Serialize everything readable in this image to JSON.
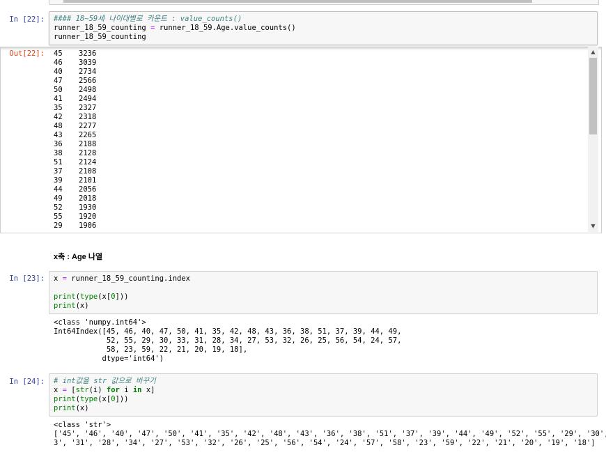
{
  "cell22": {
    "prompt_in": "In [22]:",
    "code": {
      "comment": "#### 18~59세 나이대별로 카운트 : value_counts()",
      "line2_a": "runner_18_59_counting ",
      "line2_op": "=",
      "line2_b": " runner_18_59.Age.value_counts()",
      "line3": "runner_18_59_counting"
    },
    "prompt_out": "Out[22]:",
    "value_counts": [
      {
        "age": "45",
        "count": "3236"
      },
      {
        "age": "46",
        "count": "3039"
      },
      {
        "age": "40",
        "count": "2734"
      },
      {
        "age": "47",
        "count": "2566"
      },
      {
        "age": "50",
        "count": "2498"
      },
      {
        "age": "41",
        "count": "2494"
      },
      {
        "age": "35",
        "count": "2327"
      },
      {
        "age": "42",
        "count": "2318"
      },
      {
        "age": "48",
        "count": "2277"
      },
      {
        "age": "43",
        "count": "2265"
      },
      {
        "age": "36",
        "count": "2188"
      },
      {
        "age": "38",
        "count": "2128"
      },
      {
        "age": "51",
        "count": "2124"
      },
      {
        "age": "37",
        "count": "2108"
      },
      {
        "age": "39",
        "count": "2101"
      },
      {
        "age": "44",
        "count": "2056"
      },
      {
        "age": "49",
        "count": "2018"
      },
      {
        "age": "52",
        "count": "1930"
      },
      {
        "age": "55",
        "count": "1920"
      },
      {
        "age": "29",
        "count": "1906"
      }
    ]
  },
  "markdown": {
    "text": "x축 : Age 나열"
  },
  "cell23": {
    "prompt_in": "In [23]:",
    "code": {
      "l1_a": "x ",
      "l1_op": "=",
      "l1_b": " runner_18_59_counting.index",
      "l3_fn": "print",
      "l3_a": "(",
      "l3_fn2": "type",
      "l3_b": "(x[",
      "l3_num": "0",
      "l3_c": "]))",
      "l4_fn": "print",
      "l4_b": "(x)"
    },
    "output": [
      "<class 'numpy.int64'>",
      "Int64Index([45, 46, 40, 47, 50, 41, 35, 42, 48, 43, 36, 38, 51, 37, 39, 44, 49,",
      "            52, 55, 29, 30, 33, 31, 28, 34, 27, 53, 32, 26, 25, 56, 54, 24, 57,",
      "            58, 23, 59, 22, 21, 20, 19, 18],",
      "           dtype='int64')"
    ]
  },
  "cell24": {
    "prompt_in": "In [24]:",
    "code": {
      "comment": "# int값을 str 값으로 바꾸기",
      "l2_a": "x ",
      "l2_op": "=",
      "l2_b": " [",
      "l2_fn": "str",
      "l2_c": "(i) ",
      "l2_kw1": "for",
      "l2_d": " i ",
      "l2_kw2": "in",
      "l2_e": " x]",
      "l3_fn": "print",
      "l3_a": "(",
      "l3_fn2": "type",
      "l3_b": "(x[",
      "l3_num": "0",
      "l3_c": "]))",
      "l4_fn": "print",
      "l4_b": "(x)"
    },
    "output": [
      "<class 'str'>",
      "['45', '46', '40', '47', '50', '41', '35', '42', '48', '43', '36', '38', '51', '37', '39', '44', '49', '52', '55', '29', '30', '3",
      "3', '31', '28', '34', '27', '53', '32', '26', '25', '56', '54', '24', '57', '58', '23', '59', '22', '21', '20', '19', '18']"
    ]
  },
  "colors": {
    "prompt_in": "#303f9f",
    "prompt_out": "#d84315",
    "comment": "#408080",
    "operator": "#aa22ff",
    "builtin": "#008000"
  }
}
